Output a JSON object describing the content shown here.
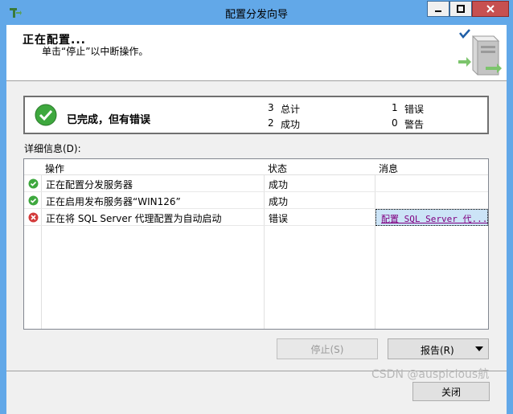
{
  "window": {
    "title": "配置分发向导",
    "accent_color": "#62a8e8",
    "controls": {
      "minimize": "minimize-icon",
      "maximize": "maximize-icon",
      "close": "close-icon"
    }
  },
  "header": {
    "title": "正在配置...",
    "subtitle": "单击“停止”以中断操作。"
  },
  "status": {
    "text": "已完成，但有错误",
    "total_count": "3",
    "total_label": "总计",
    "success_count": "2",
    "success_label": "成功",
    "error_count": "1",
    "error_label": "错误",
    "warning_count": "0",
    "warning_label": "警告"
  },
  "details": {
    "label": "详细信息(D):",
    "columns": [
      "操作",
      "状态",
      "消息"
    ],
    "rows": [
      {
        "icon": "success-icon",
        "action": "正在配置分发服务器",
        "status": "成功",
        "message": ""
      },
      {
        "icon": "success-icon",
        "action": "正在启用发布服务器“WIN126”",
        "status": "成功",
        "message": ""
      },
      {
        "icon": "error-icon",
        "action": "正在将 SQL Server 代理配置为自动启动",
        "status": "错误",
        "message": "配置 SQL Server 代..."
      }
    ]
  },
  "buttons": {
    "stop": "停止(S)",
    "report": "报告(R)",
    "close": "关闭"
  },
  "watermark": "CSDN @auspicious航"
}
